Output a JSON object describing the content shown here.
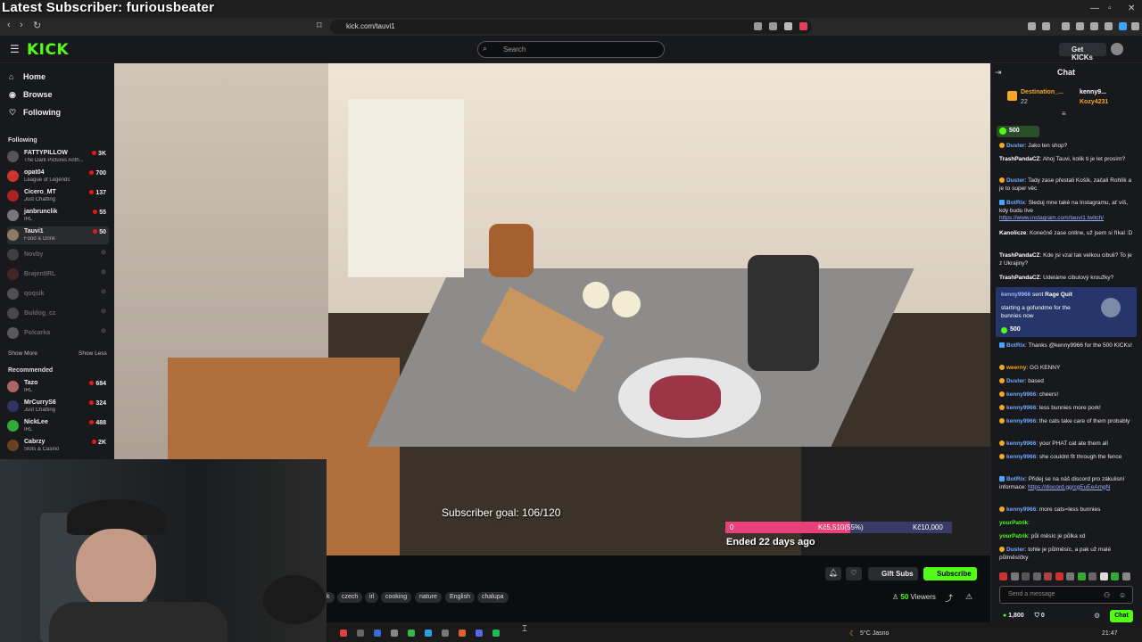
{
  "overlay": {
    "latest_subscriber": "Latest Subscriber: furiousbeater"
  },
  "browser": {
    "url": "kick.com/tauvi1"
  },
  "header": {
    "logo": "KICK",
    "search_placeholder": "Search",
    "get_kicks": "Get KICKs"
  },
  "sidebar": {
    "nav": [
      {
        "label": "Home",
        "icon": "home-icon"
      },
      {
        "label": "Browse",
        "icon": "compass-icon"
      },
      {
        "label": "Following",
        "icon": "heart-icon"
      }
    ],
    "following_title": "Following",
    "following": [
      {
        "name": "FATTYPILLOW",
        "category": "The Dark Pictures Anth...",
        "viewers": "3K",
        "live": true,
        "color": "#555"
      },
      {
        "name": "opat04",
        "category": "League of Legends",
        "viewers": "700",
        "live": true,
        "color": "#c33"
      },
      {
        "name": "Cicero_MT",
        "category": "Just Chatting",
        "viewers": "137",
        "live": true,
        "color": "#a22"
      },
      {
        "name": "janbrunclik",
        "category": "IRL",
        "viewers": "55",
        "live": true,
        "color": "#777"
      },
      {
        "name": "Tauvi1",
        "category": "Food & Drink",
        "viewers": "50",
        "live": true,
        "color": "#8a7a66"
      },
      {
        "name": "Novby",
        "category": "",
        "viewers": "",
        "live": false,
        "color": "#666"
      },
      {
        "name": "BrajentIRL",
        "category": "",
        "viewers": "",
        "live": false,
        "color": "#733"
      },
      {
        "name": "qoqsik",
        "category": "",
        "viewers": "",
        "live": false,
        "color": "#888"
      },
      {
        "name": "Buldog_cz",
        "category": "",
        "viewers": "",
        "live": false,
        "color": "#777"
      },
      {
        "name": "Polcarka",
        "category": "",
        "viewers": "",
        "live": false,
        "color": "#999"
      }
    ],
    "show_more": "Show More",
    "show_less": "Show Less",
    "recommended_title": "Recommended",
    "recommended": [
      {
        "name": "Tazo",
        "category": "IRL",
        "viewers": "684",
        "color": "#a66"
      },
      {
        "name": "MrCurryS6",
        "category": "Just Chatting",
        "viewers": "324",
        "color": "#336"
      },
      {
        "name": "NickLee",
        "category": "IRL",
        "viewers": "488",
        "color": "#3a3"
      },
      {
        "name": "Cabrzy",
        "category": "Slots & Casino",
        "viewers": "2K",
        "color": "#642"
      }
    ]
  },
  "stream": {
    "subscriber_goal": "Subscriber goal: 106/120",
    "goal_bar": {
      "left": "0",
      "mid": "Kč5,510(55%)",
      "right": "Kč10,000",
      "fraction": 0.55
    },
    "ended": "Ended 22 days ago",
    "tags": [
      "k",
      "czech",
      "irl",
      "cooking",
      "nature",
      "English",
      "chalupa"
    ],
    "gift_subs": "Gift Subs",
    "subscribe": "Subscribe",
    "viewers_count": "50",
    "viewers_label": "Viewers"
  },
  "chat": {
    "title": "Chat",
    "pinned": {
      "user1": "Destination_...",
      "count": "22",
      "user2": "kenny9...",
      "user3": "Kozy4231"
    },
    "kicks_pill": "500",
    "messages": [
      {
        "user": "Duster",
        "color": "#6fa8ff",
        "text": ": Jako ten shop?",
        "badge": "o"
      },
      {
        "user": "TrashPandaCZ",
        "color": "#ffffff",
        "text": ": Ahoj Tauvi, kolik ti je let prosím?",
        "badge": ""
      },
      {
        "user": "Duster",
        "color": "#6fa8ff",
        "text": ": Tady zase přestali Košík, začali Rohlík a je to super věc",
        "badge": "o"
      },
      {
        "user": "BotRix",
        "color": "#6fa8ff",
        "text": ": Sleduj mne také na Instagramu, ať víš, kdy budu live ",
        "link": "https://www.instagram.com/tauvi1.twitch/",
        "badge": "b"
      },
      {
        "user": "Kanolicze",
        "color": "#ffffff",
        "text": ": Konečně zase online, už jsem si říkal :D",
        "badge": ""
      },
      {
        "user": "TrashPandaCZ",
        "color": "#ffffff",
        "text": ": Kde jsi vzal tak velkou cibuli? To je z Ukrajiny?",
        "badge": ""
      },
      {
        "user": "TrashPandaCZ",
        "color": "#ffffff",
        "text": ": Udeláme cibulový kroužky?",
        "badge": ""
      }
    ],
    "rage_quit": {
      "user": "kenny9966",
      "action": " sent ",
      "item": "Rage Quit",
      "text": "starting a gofundme for the bunnies now",
      "amount": "500"
    },
    "messages2": [
      {
        "user": "BotRix",
        "color": "#6fa8ff",
        "text": ": Thanks @kenny9966 for the 500 KICKs!",
        "badge": "b"
      },
      {
        "user": "weerny",
        "color": "#f5a623",
        "text": ": GG KENNY",
        "badge": "o"
      },
      {
        "user": "Duster",
        "color": "#6fa8ff",
        "text": ": based",
        "badge": "o"
      },
      {
        "user": "kenny9966",
        "color": "#6fa8ff",
        "text": ": cheers!",
        "badge": "o"
      },
      {
        "user": "kenny9966",
        "color": "#6fa8ff",
        "text": ": less bunnies more pork!",
        "badge": "o"
      },
      {
        "user": "kenny9966",
        "color": "#6fa8ff",
        "text": ": the cats take care of them probably",
        "badge": "o"
      },
      {
        "user": "kenny9966",
        "color": "#6fa8ff",
        "text": ": your PHAT cat ate them all",
        "badge": "o"
      },
      {
        "user": "kenny9966",
        "color": "#6fa8ff",
        "text": ": she couldnt fit through the fence",
        "badge": "o"
      },
      {
        "user": "BotRix",
        "color": "#6fa8ff",
        "text": ": Přidej se na náš discord pro zákulisní informace: ",
        "link": "https://discord.gg/cgEuEeAmgN",
        "badge": "b"
      },
      {
        "user": "kenny9966",
        "color": "#6fa8ff",
        "text": ": more cats=less bunnies",
        "badge": "o"
      },
      {
        "user": "yourPatrik",
        "color": "#53fc18",
        "text": ":",
        "badge": ""
      },
      {
        "user": "yourPatrik",
        "color": "#53fc18",
        "text": ": půl měsíc je půlka xd",
        "badge": ""
      },
      {
        "user": "Duster",
        "color": "#6fa8ff",
        "text": ": tohle je půlměsíc, a pak už malé půlměsíčky",
        "badge": "o"
      }
    ],
    "input_placeholder": "Send a message",
    "kicks_balance": "1,800",
    "other_balance": "0",
    "send_label": "Chat"
  },
  "taskbar": {
    "weather": "5°C  Jasno",
    "time": "21:47"
  }
}
